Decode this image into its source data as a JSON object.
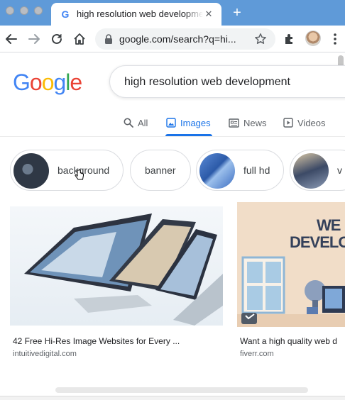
{
  "browser": {
    "tab_title": "high resolution web development",
    "tab_favicon": "G",
    "close_glyph": "✕",
    "new_tab_glyph": "+",
    "url": "google.com/search?q=hi...",
    "accent": "#5f9ad8"
  },
  "google": {
    "logo_letters": [
      "G",
      "o",
      "o",
      "g",
      "l",
      "e"
    ],
    "logo_colors": [
      "#4285f4",
      "#ea4335",
      "#fbbc05",
      "#4285f4",
      "#34a853",
      "#ea4335"
    ],
    "query": "high resolution web development"
  },
  "filters": [
    {
      "label": "All",
      "icon": "search-icon"
    },
    {
      "label": "Images",
      "icon": "image-icon",
      "active": true
    },
    {
      "label": "News",
      "icon": "news-icon"
    },
    {
      "label": "Videos",
      "icon": "video-icon"
    }
  ],
  "chips": [
    {
      "label": "background"
    },
    {
      "label": "banner"
    },
    {
      "label": "full hd"
    },
    {
      "label": "v"
    }
  ],
  "results": [
    {
      "title": "42 Free Hi-Res Image Websites for Every ...",
      "source": "intuitivedigital.com"
    },
    {
      "title": "Want a high quality web d",
      "source": "fiverr.com",
      "image_text_1": "WE",
      "image_text_2": "DEVELOP"
    }
  ]
}
